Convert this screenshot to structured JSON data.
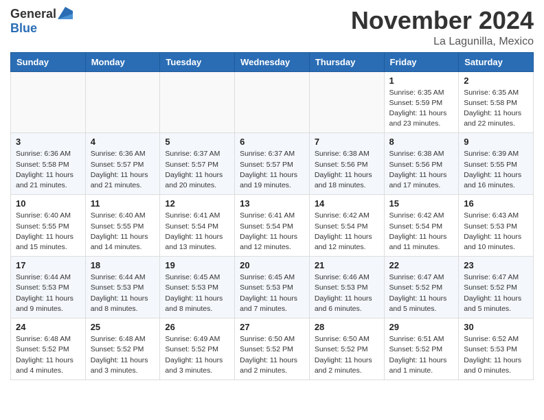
{
  "header": {
    "logo_general": "General",
    "logo_blue": "Blue",
    "month_title": "November 2024",
    "location": "La Lagunilla, Mexico"
  },
  "weekdays": [
    "Sunday",
    "Monday",
    "Tuesday",
    "Wednesday",
    "Thursday",
    "Friday",
    "Saturday"
  ],
  "weeks": [
    [
      {
        "day": "",
        "info": ""
      },
      {
        "day": "",
        "info": ""
      },
      {
        "day": "",
        "info": ""
      },
      {
        "day": "",
        "info": ""
      },
      {
        "day": "",
        "info": ""
      },
      {
        "day": "1",
        "info": "Sunrise: 6:35 AM\nSunset: 5:59 PM\nDaylight: 11 hours and 23 minutes."
      },
      {
        "day": "2",
        "info": "Sunrise: 6:35 AM\nSunset: 5:58 PM\nDaylight: 11 hours and 22 minutes."
      }
    ],
    [
      {
        "day": "3",
        "info": "Sunrise: 6:36 AM\nSunset: 5:58 PM\nDaylight: 11 hours and 21 minutes."
      },
      {
        "day": "4",
        "info": "Sunrise: 6:36 AM\nSunset: 5:57 PM\nDaylight: 11 hours and 21 minutes."
      },
      {
        "day": "5",
        "info": "Sunrise: 6:37 AM\nSunset: 5:57 PM\nDaylight: 11 hours and 20 minutes."
      },
      {
        "day": "6",
        "info": "Sunrise: 6:37 AM\nSunset: 5:57 PM\nDaylight: 11 hours and 19 minutes."
      },
      {
        "day": "7",
        "info": "Sunrise: 6:38 AM\nSunset: 5:56 PM\nDaylight: 11 hours and 18 minutes."
      },
      {
        "day": "8",
        "info": "Sunrise: 6:38 AM\nSunset: 5:56 PM\nDaylight: 11 hours and 17 minutes."
      },
      {
        "day": "9",
        "info": "Sunrise: 6:39 AM\nSunset: 5:55 PM\nDaylight: 11 hours and 16 minutes."
      }
    ],
    [
      {
        "day": "10",
        "info": "Sunrise: 6:40 AM\nSunset: 5:55 PM\nDaylight: 11 hours and 15 minutes."
      },
      {
        "day": "11",
        "info": "Sunrise: 6:40 AM\nSunset: 5:55 PM\nDaylight: 11 hours and 14 minutes."
      },
      {
        "day": "12",
        "info": "Sunrise: 6:41 AM\nSunset: 5:54 PM\nDaylight: 11 hours and 13 minutes."
      },
      {
        "day": "13",
        "info": "Sunrise: 6:41 AM\nSunset: 5:54 PM\nDaylight: 11 hours and 12 minutes."
      },
      {
        "day": "14",
        "info": "Sunrise: 6:42 AM\nSunset: 5:54 PM\nDaylight: 11 hours and 12 minutes."
      },
      {
        "day": "15",
        "info": "Sunrise: 6:42 AM\nSunset: 5:54 PM\nDaylight: 11 hours and 11 minutes."
      },
      {
        "day": "16",
        "info": "Sunrise: 6:43 AM\nSunset: 5:53 PM\nDaylight: 11 hours and 10 minutes."
      }
    ],
    [
      {
        "day": "17",
        "info": "Sunrise: 6:44 AM\nSunset: 5:53 PM\nDaylight: 11 hours and 9 minutes."
      },
      {
        "day": "18",
        "info": "Sunrise: 6:44 AM\nSunset: 5:53 PM\nDaylight: 11 hours and 8 minutes."
      },
      {
        "day": "19",
        "info": "Sunrise: 6:45 AM\nSunset: 5:53 PM\nDaylight: 11 hours and 8 minutes."
      },
      {
        "day": "20",
        "info": "Sunrise: 6:45 AM\nSunset: 5:53 PM\nDaylight: 11 hours and 7 minutes."
      },
      {
        "day": "21",
        "info": "Sunrise: 6:46 AM\nSunset: 5:53 PM\nDaylight: 11 hours and 6 minutes."
      },
      {
        "day": "22",
        "info": "Sunrise: 6:47 AM\nSunset: 5:52 PM\nDaylight: 11 hours and 5 minutes."
      },
      {
        "day": "23",
        "info": "Sunrise: 6:47 AM\nSunset: 5:52 PM\nDaylight: 11 hours and 5 minutes."
      }
    ],
    [
      {
        "day": "24",
        "info": "Sunrise: 6:48 AM\nSunset: 5:52 PM\nDaylight: 11 hours and 4 minutes."
      },
      {
        "day": "25",
        "info": "Sunrise: 6:48 AM\nSunset: 5:52 PM\nDaylight: 11 hours and 3 minutes."
      },
      {
        "day": "26",
        "info": "Sunrise: 6:49 AM\nSunset: 5:52 PM\nDaylight: 11 hours and 3 minutes."
      },
      {
        "day": "27",
        "info": "Sunrise: 6:50 AM\nSunset: 5:52 PM\nDaylight: 11 hours and 2 minutes."
      },
      {
        "day": "28",
        "info": "Sunrise: 6:50 AM\nSunset: 5:52 PM\nDaylight: 11 hours and 2 minutes."
      },
      {
        "day": "29",
        "info": "Sunrise: 6:51 AM\nSunset: 5:52 PM\nDaylight: 11 hours and 1 minute."
      },
      {
        "day": "30",
        "info": "Sunrise: 6:52 AM\nSunset: 5:53 PM\nDaylight: 11 hours and 0 minutes."
      }
    ]
  ]
}
